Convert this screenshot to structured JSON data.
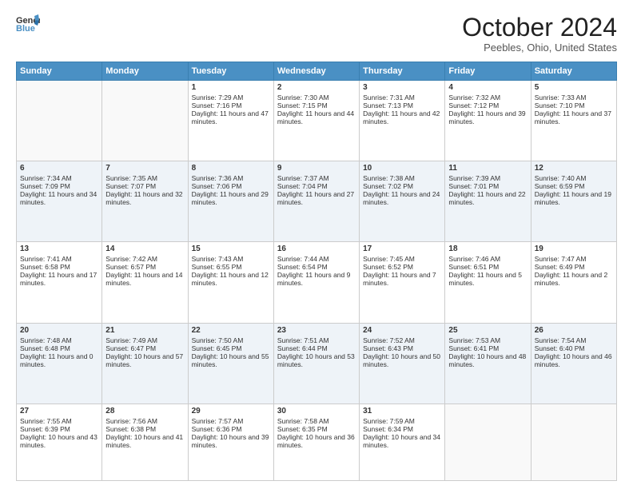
{
  "logo": {
    "line1": "General",
    "line2": "Blue"
  },
  "title": "October 2024",
  "location": "Peebles, Ohio, United States",
  "weekdays": [
    "Sunday",
    "Monday",
    "Tuesday",
    "Wednesday",
    "Thursday",
    "Friday",
    "Saturday"
  ],
  "weeks": [
    [
      {
        "day": "",
        "sunrise": "",
        "sunset": "",
        "daylight": ""
      },
      {
        "day": "",
        "sunrise": "",
        "sunset": "",
        "daylight": ""
      },
      {
        "day": "1",
        "sunrise": "Sunrise: 7:29 AM",
        "sunset": "Sunset: 7:16 PM",
        "daylight": "Daylight: 11 hours and 47 minutes."
      },
      {
        "day": "2",
        "sunrise": "Sunrise: 7:30 AM",
        "sunset": "Sunset: 7:15 PM",
        "daylight": "Daylight: 11 hours and 44 minutes."
      },
      {
        "day": "3",
        "sunrise": "Sunrise: 7:31 AM",
        "sunset": "Sunset: 7:13 PM",
        "daylight": "Daylight: 11 hours and 42 minutes."
      },
      {
        "day": "4",
        "sunrise": "Sunrise: 7:32 AM",
        "sunset": "Sunset: 7:12 PM",
        "daylight": "Daylight: 11 hours and 39 minutes."
      },
      {
        "day": "5",
        "sunrise": "Sunrise: 7:33 AM",
        "sunset": "Sunset: 7:10 PM",
        "daylight": "Daylight: 11 hours and 37 minutes."
      }
    ],
    [
      {
        "day": "6",
        "sunrise": "Sunrise: 7:34 AM",
        "sunset": "Sunset: 7:09 PM",
        "daylight": "Daylight: 11 hours and 34 minutes."
      },
      {
        "day": "7",
        "sunrise": "Sunrise: 7:35 AM",
        "sunset": "Sunset: 7:07 PM",
        "daylight": "Daylight: 11 hours and 32 minutes."
      },
      {
        "day": "8",
        "sunrise": "Sunrise: 7:36 AM",
        "sunset": "Sunset: 7:06 PM",
        "daylight": "Daylight: 11 hours and 29 minutes."
      },
      {
        "day": "9",
        "sunrise": "Sunrise: 7:37 AM",
        "sunset": "Sunset: 7:04 PM",
        "daylight": "Daylight: 11 hours and 27 minutes."
      },
      {
        "day": "10",
        "sunrise": "Sunrise: 7:38 AM",
        "sunset": "Sunset: 7:02 PM",
        "daylight": "Daylight: 11 hours and 24 minutes."
      },
      {
        "day": "11",
        "sunrise": "Sunrise: 7:39 AM",
        "sunset": "Sunset: 7:01 PM",
        "daylight": "Daylight: 11 hours and 22 minutes."
      },
      {
        "day": "12",
        "sunrise": "Sunrise: 7:40 AM",
        "sunset": "Sunset: 6:59 PM",
        "daylight": "Daylight: 11 hours and 19 minutes."
      }
    ],
    [
      {
        "day": "13",
        "sunrise": "Sunrise: 7:41 AM",
        "sunset": "Sunset: 6:58 PM",
        "daylight": "Daylight: 11 hours and 17 minutes."
      },
      {
        "day": "14",
        "sunrise": "Sunrise: 7:42 AM",
        "sunset": "Sunset: 6:57 PM",
        "daylight": "Daylight: 11 hours and 14 minutes."
      },
      {
        "day": "15",
        "sunrise": "Sunrise: 7:43 AM",
        "sunset": "Sunset: 6:55 PM",
        "daylight": "Daylight: 11 hours and 12 minutes."
      },
      {
        "day": "16",
        "sunrise": "Sunrise: 7:44 AM",
        "sunset": "Sunset: 6:54 PM",
        "daylight": "Daylight: 11 hours and 9 minutes."
      },
      {
        "day": "17",
        "sunrise": "Sunrise: 7:45 AM",
        "sunset": "Sunset: 6:52 PM",
        "daylight": "Daylight: 11 hours and 7 minutes."
      },
      {
        "day": "18",
        "sunrise": "Sunrise: 7:46 AM",
        "sunset": "Sunset: 6:51 PM",
        "daylight": "Daylight: 11 hours and 5 minutes."
      },
      {
        "day": "19",
        "sunrise": "Sunrise: 7:47 AM",
        "sunset": "Sunset: 6:49 PM",
        "daylight": "Daylight: 11 hours and 2 minutes."
      }
    ],
    [
      {
        "day": "20",
        "sunrise": "Sunrise: 7:48 AM",
        "sunset": "Sunset: 6:48 PM",
        "daylight": "Daylight: 11 hours and 0 minutes."
      },
      {
        "day": "21",
        "sunrise": "Sunrise: 7:49 AM",
        "sunset": "Sunset: 6:47 PM",
        "daylight": "Daylight: 10 hours and 57 minutes."
      },
      {
        "day": "22",
        "sunrise": "Sunrise: 7:50 AM",
        "sunset": "Sunset: 6:45 PM",
        "daylight": "Daylight: 10 hours and 55 minutes."
      },
      {
        "day": "23",
        "sunrise": "Sunrise: 7:51 AM",
        "sunset": "Sunset: 6:44 PM",
        "daylight": "Daylight: 10 hours and 53 minutes."
      },
      {
        "day": "24",
        "sunrise": "Sunrise: 7:52 AM",
        "sunset": "Sunset: 6:43 PM",
        "daylight": "Daylight: 10 hours and 50 minutes."
      },
      {
        "day": "25",
        "sunrise": "Sunrise: 7:53 AM",
        "sunset": "Sunset: 6:41 PM",
        "daylight": "Daylight: 10 hours and 48 minutes."
      },
      {
        "day": "26",
        "sunrise": "Sunrise: 7:54 AM",
        "sunset": "Sunset: 6:40 PM",
        "daylight": "Daylight: 10 hours and 46 minutes."
      }
    ],
    [
      {
        "day": "27",
        "sunrise": "Sunrise: 7:55 AM",
        "sunset": "Sunset: 6:39 PM",
        "daylight": "Daylight: 10 hours and 43 minutes."
      },
      {
        "day": "28",
        "sunrise": "Sunrise: 7:56 AM",
        "sunset": "Sunset: 6:38 PM",
        "daylight": "Daylight: 10 hours and 41 minutes."
      },
      {
        "day": "29",
        "sunrise": "Sunrise: 7:57 AM",
        "sunset": "Sunset: 6:36 PM",
        "daylight": "Daylight: 10 hours and 39 minutes."
      },
      {
        "day": "30",
        "sunrise": "Sunrise: 7:58 AM",
        "sunset": "Sunset: 6:35 PM",
        "daylight": "Daylight: 10 hours and 36 minutes."
      },
      {
        "day": "31",
        "sunrise": "Sunrise: 7:59 AM",
        "sunset": "Sunset: 6:34 PM",
        "daylight": "Daylight: 10 hours and 34 minutes."
      },
      {
        "day": "",
        "sunrise": "",
        "sunset": "",
        "daylight": ""
      },
      {
        "day": "",
        "sunrise": "",
        "sunset": "",
        "daylight": ""
      }
    ]
  ]
}
